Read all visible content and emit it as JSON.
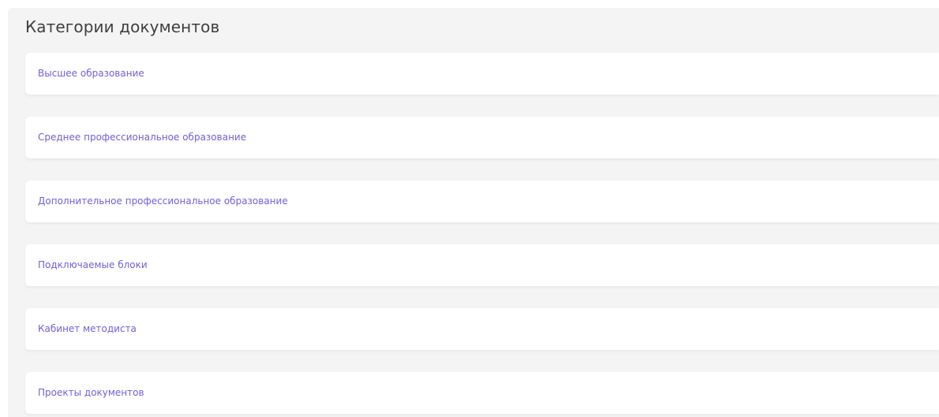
{
  "page": {
    "title": "Категории документов"
  },
  "categories": [
    {
      "label": "Высшее образование"
    },
    {
      "label": "Среднее профессиональное образование"
    },
    {
      "label": "Дополнительное профессиональное образование"
    },
    {
      "label": "Подключаемые блоки"
    },
    {
      "label": "Кабинет методиста"
    },
    {
      "label": "Проекты документов"
    }
  ],
  "colors": {
    "link": "#7260d6",
    "title": "#3f3f3f",
    "panel_background": "#f4f4f4",
    "card_background": "#ffffff"
  }
}
